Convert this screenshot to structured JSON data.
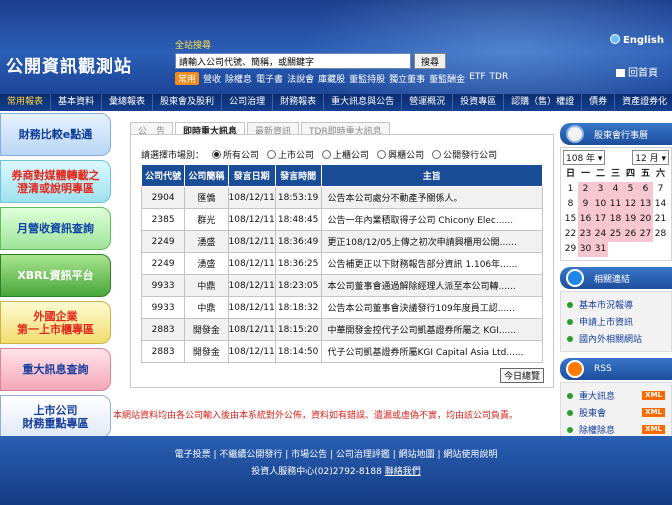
{
  "header": {
    "logo": "公開資訊觀測站",
    "search_title": "全站搜尋",
    "search_placeholder": "請輸入公司代號、簡稱，或關鍵字",
    "search_button": "搜尋",
    "quick_tag": "常用",
    "quick_links": [
      "營收",
      "除權息",
      "電子書",
      "法說會",
      "庫藏股",
      "董監持股",
      "獨立董事",
      "董監酬金",
      "ETF",
      "TDR"
    ],
    "lang": "English",
    "home": "回首頁"
  },
  "nav": {
    "items": [
      "常用報表",
      "基本資料",
      "彙總報表",
      "股東會及股利",
      "公司治理",
      "財務報表",
      "重大訊息與公告",
      "營運概況",
      "投資專區",
      "認購（售）權證",
      "債券",
      "資產證券化"
    ],
    "active": 0
  },
  "sidebar": {
    "buttons": [
      "財務比較e點通",
      "券商對媒體轉載之\n澄清或說明專區",
      "月營收資訊查詢",
      "XBRL資訊平台",
      "外國企業\n第一上市櫃專區",
      "重大訊息查詢",
      "上市公司\n財務重點專區"
    ]
  },
  "tabs": [
    "公　告",
    "即時重大訊息",
    "最新資訊",
    "TDR即時重大訊息"
  ],
  "active_tab": 1,
  "filter": {
    "label": "請選擇市場別：",
    "options": [
      "所有公司",
      "上市公司",
      "上櫃公司",
      "興櫃公司",
      "公開發行公司"
    ],
    "selected": 0
  },
  "table": {
    "headers": [
      "公司代號",
      "公司簡稱",
      "發言日期",
      "發言時間",
      "主旨"
    ],
    "rows": [
      [
        "2904",
        "匯僑",
        "108/12/11",
        "18:53:19",
        "公告本公司處分不動產予關係人。"
      ],
      [
        "2385",
        "群光",
        "108/12/11",
        "18:48:45",
        "公告一年內業積取得子公司 Chicony Elec......"
      ],
      [
        "2249",
        "湧盛",
        "108/12/11",
        "18:36:49",
        "更正108/12/05上傳之初次申請興櫃用公開......"
      ],
      [
        "2249",
        "湧盛",
        "108/12/11",
        "18:36:25",
        "公告補更正以下財務報告部分資訊 1.106年......"
      ],
      [
        "9933",
        "中鼎",
        "108/12/11",
        "18:23:05",
        "本公司董事會通過解除經理人派至本公司轉......"
      ],
      [
        "9933",
        "中鼎",
        "108/12/11",
        "18:18:32",
        "公告本公司董事會決議發行109年度員工認......"
      ],
      [
        "2883",
        "開發金",
        "108/12/11",
        "18:15:20",
        "中華開發金控代子公司凱基證券所屬之 KGI......"
      ],
      [
        "2883",
        "開發金",
        "108/12/11",
        "18:14:50",
        "代子公司凱基證券所屬KGI Capital Asia Ltd......"
      ]
    ],
    "today_button": "今日總覽"
  },
  "disclaimer": "本網站資料均由各公司輸入後由本系統對外公佈，資料如有錯誤、遺漏或虛偽不實，均由該公司負責。",
  "right": {
    "calendar_title": "股東會行事曆",
    "year": "108 年",
    "month": "12 月",
    "weekdays": [
      "日",
      "一",
      "二",
      "三",
      "四",
      "五",
      "六"
    ],
    "days": [
      "1",
      "2",
      "3",
      "4",
      "5",
      "6",
      "7",
      "8",
      "9",
      "10",
      "11",
      "12",
      "13",
      "14",
      "15",
      "16",
      "17",
      "18",
      "19",
      "20",
      "21",
      "22",
      "23",
      "24",
      "25",
      "26",
      "27",
      "28",
      "29",
      "30",
      "31"
    ],
    "highlighted_days": [
      "2",
      "3",
      "4",
      "5",
      "6",
      "9",
      "10",
      "11",
      "12",
      "13",
      "16",
      "17",
      "18",
      "19",
      "20",
      "23",
      "24",
      "25",
      "26",
      "27",
      "30",
      "31"
    ],
    "related_title": "相關連結",
    "related_links": [
      "基本市況報導",
      "申請上市資訊",
      "國內外相關網站"
    ],
    "rss_title": "RSS",
    "rss_links": [
      "重大訊息",
      "股東會",
      "除權除息"
    ],
    "xml_label": "XML"
  },
  "footer": {
    "links": "電子投票 | 不繼續公開發行 | 市場公告 | 公司治理評鑑 | 網站地圖 | 網站使用說明",
    "contact": "投資人服務中心(02)2792-8188",
    "contact_link": "聯絡我們"
  },
  "colors": {
    "header_blue": "#2b5fb6",
    "nav_dark": "#0b2d70",
    "table_header": "#1a4d96",
    "disclaimer_red": "#d8241c",
    "accent_orange": "#f08a1c"
  }
}
